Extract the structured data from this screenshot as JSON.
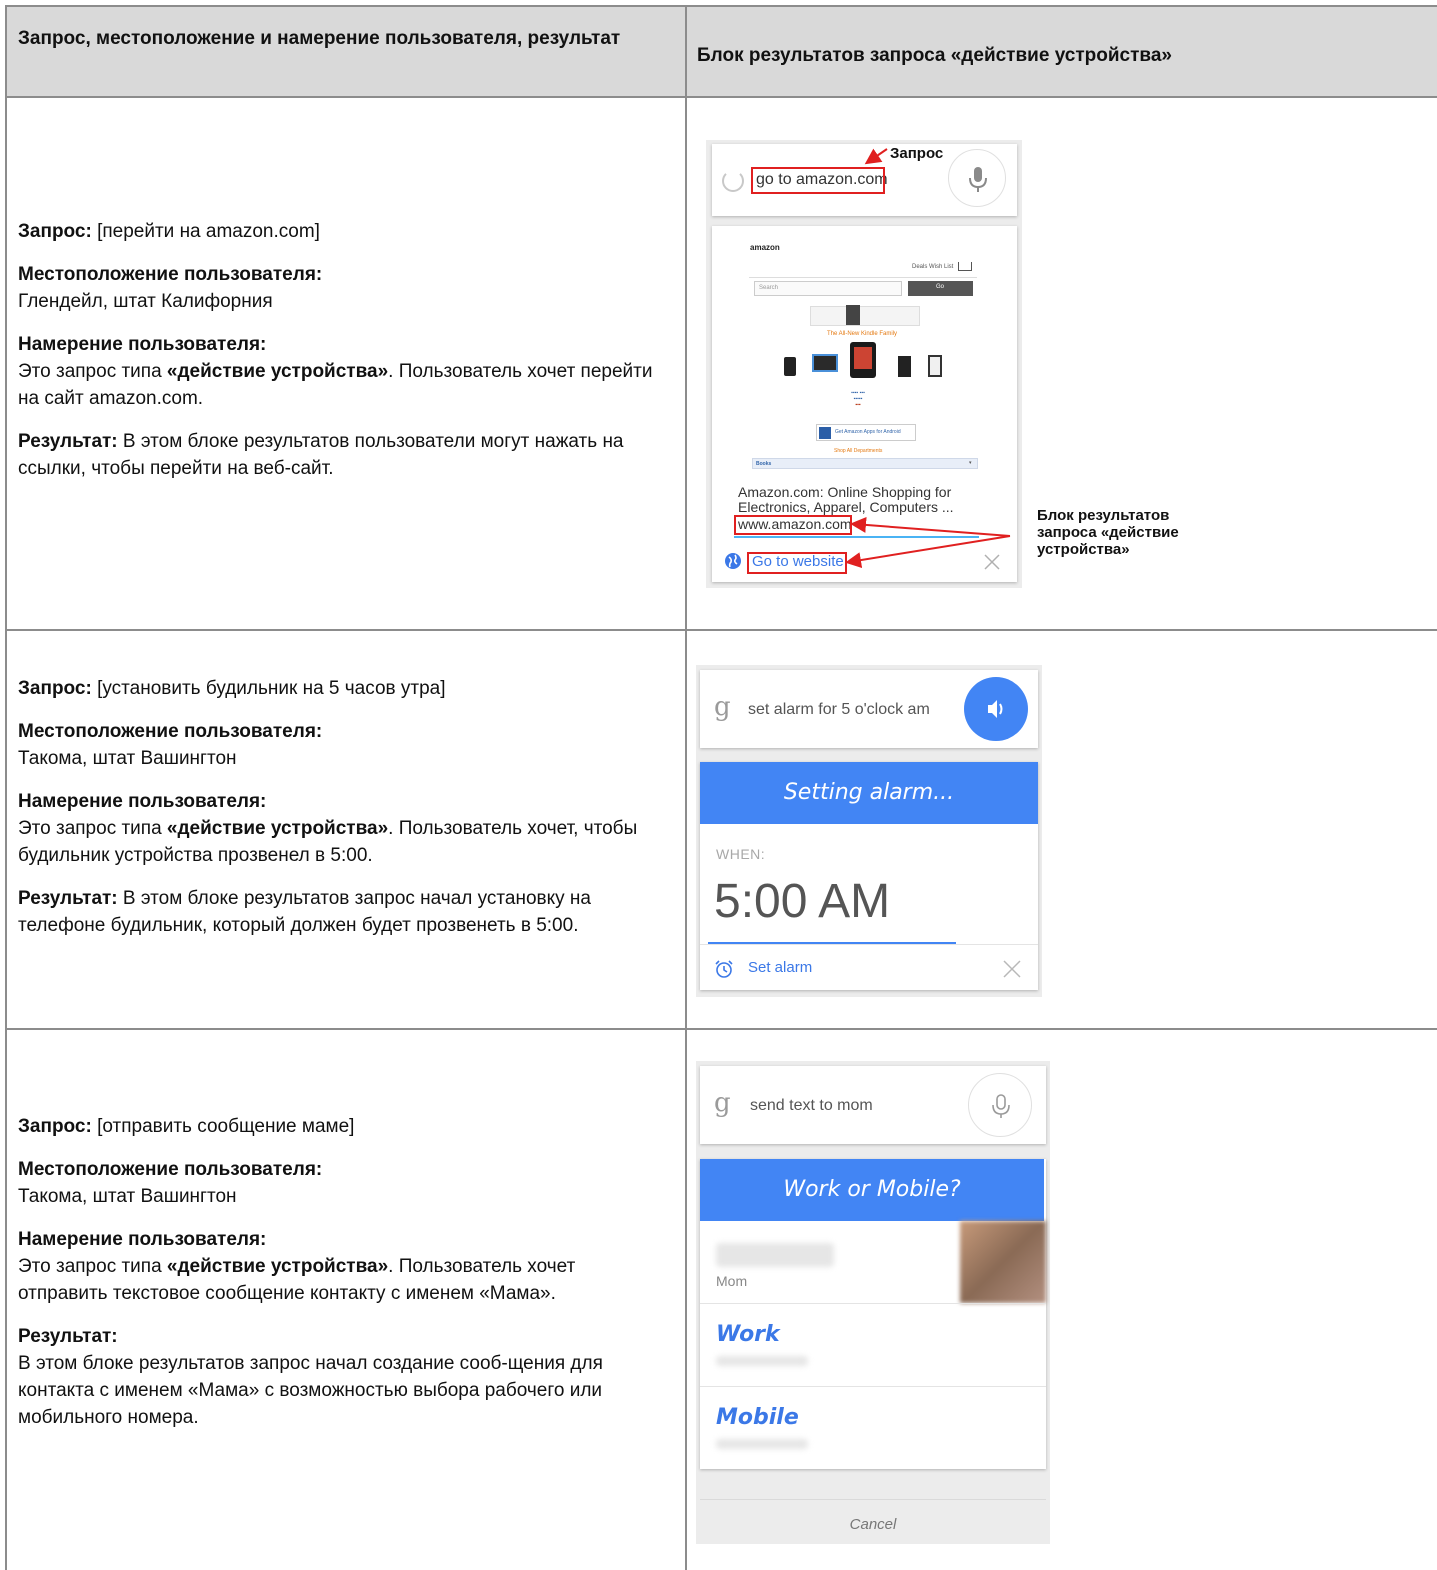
{
  "header": {
    "col1": "Запрос, местоположение и намерение пользователя, результат",
    "col2": "Блок результатов запроса «действие устройства»"
  },
  "labels": {
    "query": "Запрос:",
    "location": "Местоположение пользователя:",
    "intent": "Намерение пользователя:",
    "result": "Результат:"
  },
  "rows": [
    {
      "query": "[перейти на amazon.com]",
      "location": "Глендейл, штат Калифорния",
      "intent_pre": "Это запрос типа ",
      "intent_bold": "«действие устройства»",
      "intent_post": ". Пользователь хочет перейти на сайт amazon.com.",
      "result": "В этом блоке результатов пользователи могут нажать на ссылки, чтобы перейти на веб-сайт."
    },
    {
      "query": "[установить будильник на 5 часов утра]",
      "location": "Такома, штат Вашингтон",
      "intent_pre": "Это запрос типа ",
      "intent_bold": "«действие устройства»",
      "intent_post": ". Пользователь хочет, чтобы будильник устройства прозвенел в 5:00.",
      "result": "В этом блоке результатов запрос начал установку на телефоне будильник, который должен будет прозвенеть в 5:00."
    },
    {
      "query": "[отправить сообщение маме]",
      "location": "Такома, штат Вашингтон",
      "intent_pre": "Это запрос типа ",
      "intent_bold": "«действие устройства»",
      "intent_post": ". Пользователь хочет отправить текстовое сообщение контакту с именем «Мама».",
      "result": "В этом блоке результатов запрос начал создание сооб-щения для контакта с именем «Мама» с возможностью выбора рабочего или мобильного номера."
    }
  ],
  "amazon_card": {
    "query": "go to amazon.com",
    "annotation_query": "Запрос",
    "logo": "amazon",
    "nav": "Deals  Wish List",
    "search_placeholder": "Search",
    "go": "Go",
    "kindle_family": "The All-New Kindle Family",
    "apps": "Get Amazon Apps for Android",
    "departments": "Shop All Departments",
    "books": "Books",
    "result_title": "Amazon.com: Online Shopping for Electronics, Apparel, Computers ...",
    "url": "www.amazon.com",
    "action": "Go to website",
    "annotation_block": "Блок результатов запроса «действие устройства»"
  },
  "alarm_card": {
    "g": "g",
    "query": "set alarm for 5 o'clock am",
    "banner": "Setting alarm...",
    "when_label": "WHEN:",
    "time": "5:00 AM",
    "action": "Set alarm"
  },
  "text_card": {
    "g": "g",
    "query": "send text to mom",
    "banner": "Work or Mobile?",
    "contact_relation": "Mom",
    "option1": "Work",
    "option2": "Mobile",
    "cancel": "Cancel"
  },
  "colors": {
    "accent_blue": "#4285f4",
    "annotation_red": "#e02020",
    "header_gray": "#d9d9d9",
    "border_gray": "#8c8c8c"
  }
}
